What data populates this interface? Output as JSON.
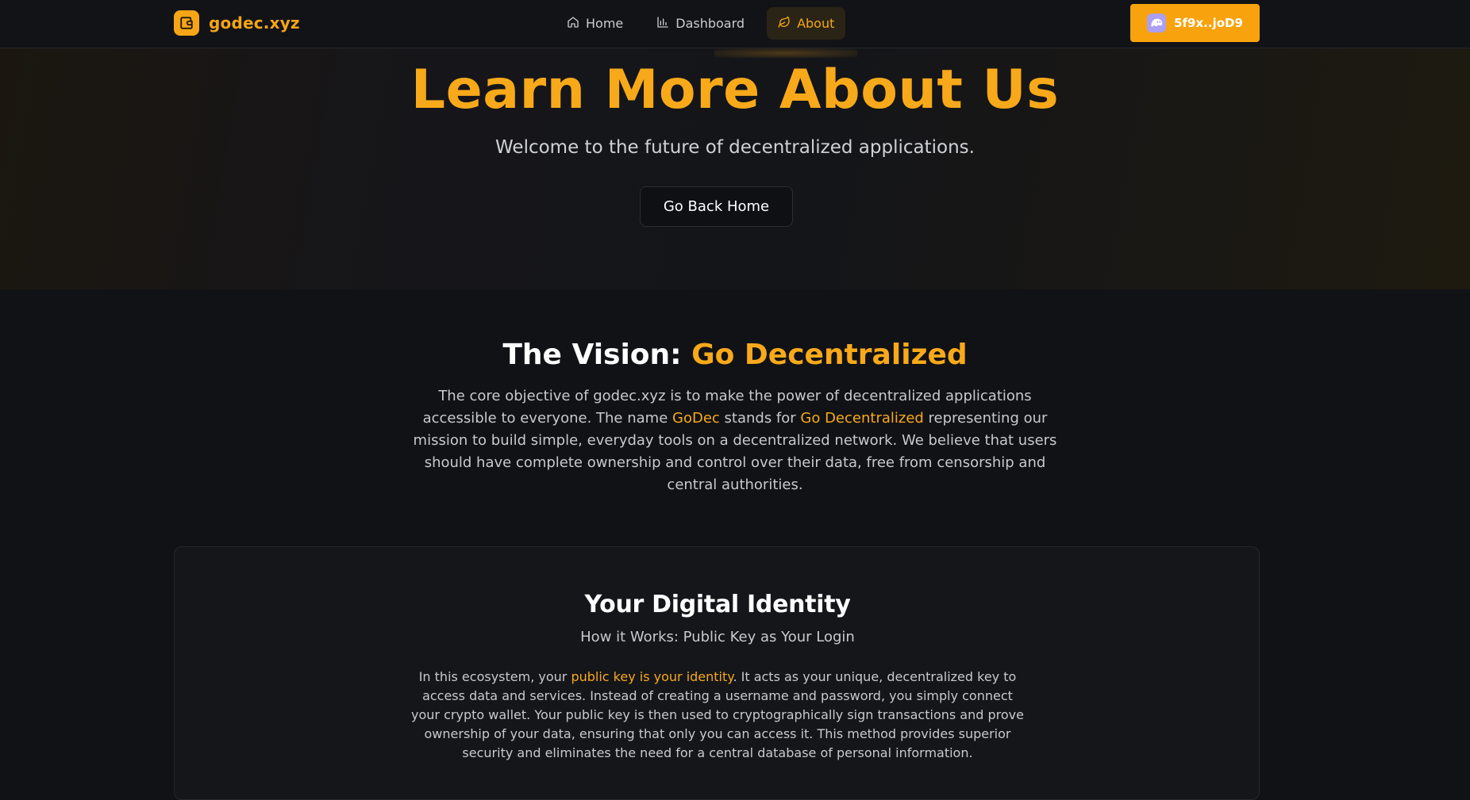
{
  "brand": {
    "name": "godec.xyz",
    "icon": "wallet-icon"
  },
  "nav": {
    "items": [
      {
        "label": "Home",
        "icon": "home-icon",
        "active": false
      },
      {
        "label": "Dashboard",
        "icon": "bar-chart-icon",
        "active": false
      },
      {
        "label": "About",
        "icon": "leaf-icon",
        "active": true
      }
    ]
  },
  "wallet": {
    "address": "5f9x..joD9",
    "icon": "phantom-ghost-icon"
  },
  "hero": {
    "title": "Learn More About Us",
    "subtitle": "Welcome to the future of decentralized applications.",
    "button": "Go Back Home"
  },
  "vision": {
    "title_prefix": "The Vision: ",
    "title_highlight": "Go Decentralized",
    "p1": "The core objective of godec.xyz is to make the power of decentralized applications accessible to everyone. The name ",
    "hl1": "GoDec",
    "p2": " stands for ",
    "hl2": "Go Decentralized",
    "p3": " representing our mission to build simple, everyday tools on a decentralized network. We believe that users should have complete ownership and control over their data, free from censorship and central authorities."
  },
  "identity": {
    "title": "Your Digital Identity",
    "subtitle": "How it Works: Public Key as Your Login",
    "p1": "In this ecosystem, your ",
    "hl1": "public key is your identity",
    "p2": ". It acts as your unique, decentralized key to access data and services. Instead of creating a username and password, you simply connect your crypto wallet. Your public key is then used to cryptographically sign transactions and prove ownership of your data, ensuring that only you can access it. This method provides superior security and eliminates the need for a central database of personal information."
  },
  "colors": {
    "accent": "#f8a91a",
    "background": "#111216",
    "wallet_button": "#f8a30d"
  }
}
